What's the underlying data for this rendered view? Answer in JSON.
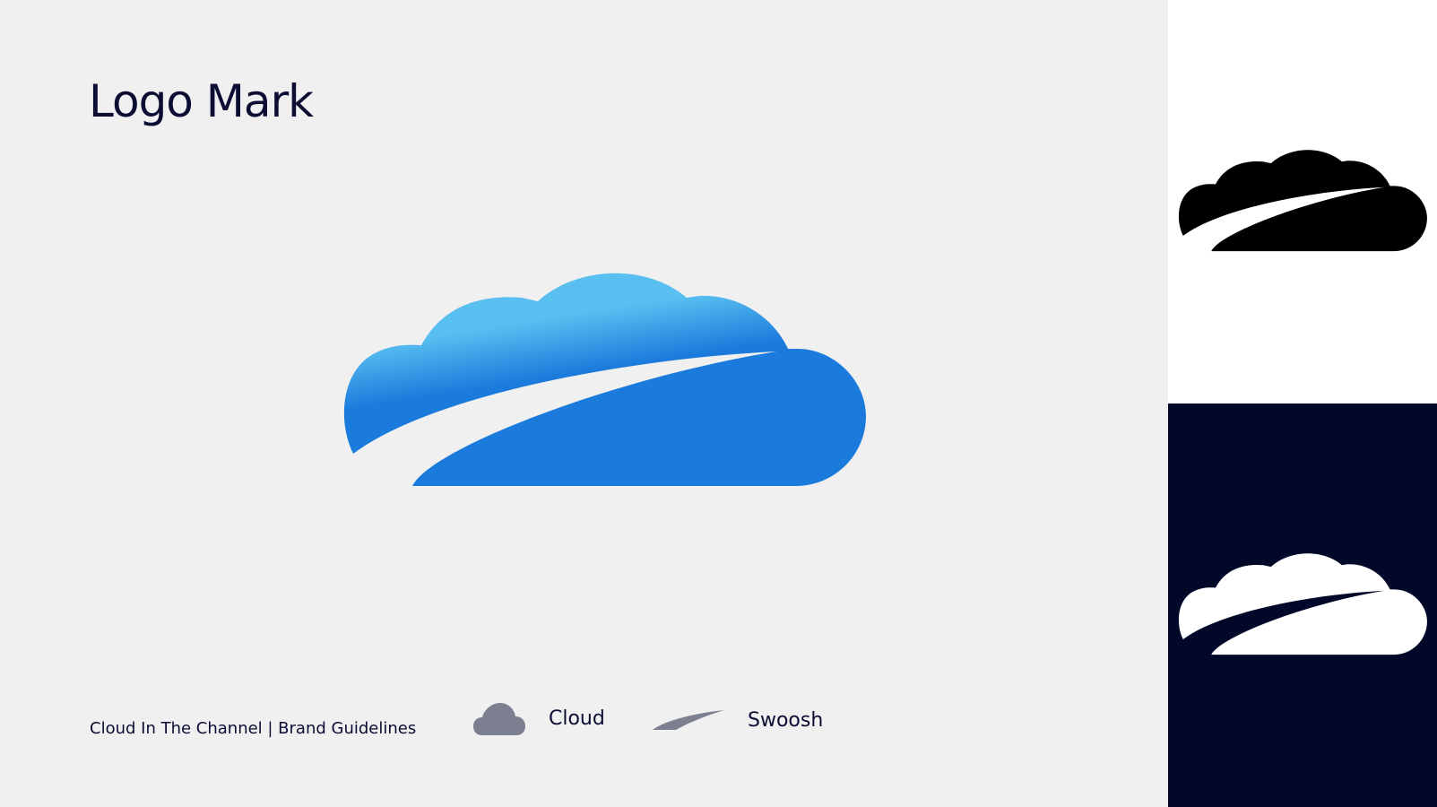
{
  "page": {
    "title": "Logo Mark",
    "footer": "Cloud In The Channel | Brand Guidelines"
  },
  "legend": [
    {
      "label": "Cloud",
      "icon": "cloud-icon"
    },
    {
      "label": "Swoosh",
      "icon": "swoosh-icon"
    }
  ],
  "colors": {
    "background": "#f0f0f0",
    "text": "#0b0d33",
    "cloud_light": "#58bff0",
    "cloud_dark": "#1b7bdc",
    "legend_icon": "#7b7f90",
    "panel_white": "#ffffff",
    "panel_navy": "#020827"
  },
  "variants": [
    {
      "name": "black-on-white",
      "fill": "#000000",
      "background": "#ffffff"
    },
    {
      "name": "white-on-navy",
      "fill": "#ffffff",
      "background": "#020827"
    }
  ]
}
